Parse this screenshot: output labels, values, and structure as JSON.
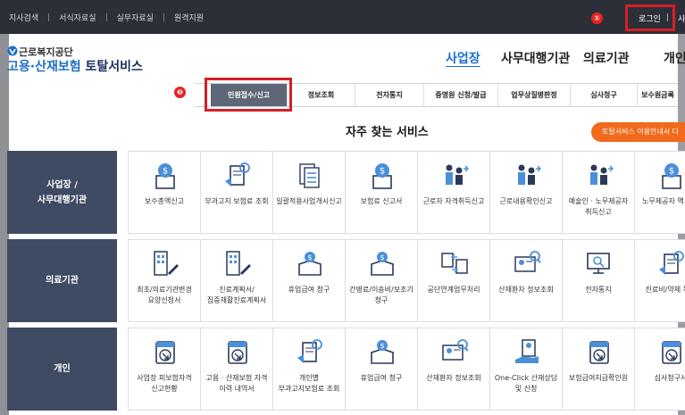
{
  "utility_links": [
    "지사검색",
    "서식자료실",
    "실무자료실",
    "원격지원"
  ],
  "login": "로그인",
  "cut_menu": "사",
  "badges": {
    "one": "①",
    "two": "❷"
  },
  "org_name": "근로복지공단",
  "service_title": {
    "accent": "고용·산재보험",
    "rest": " 토탈서비스"
  },
  "main_nav": [
    "사업장",
    "사무대행기관",
    "의료기관",
    "개인"
  ],
  "sub_nav": [
    "민원접수/신고",
    "정보조회",
    "전자통지",
    "증명원 신청/발급",
    "업무상질병판정",
    "심사청구",
    "보수원금록"
  ],
  "section_title": "자주 찾는 서비스",
  "guide_button": "토탈서비스 이용안내서 다",
  "categories": [
    {
      "line1": "사업장 /",
      "line2": "사무대행기관"
    },
    {
      "line1": "의료기관",
      "line2": ""
    },
    {
      "line1": "개인",
      "line2": ""
    }
  ],
  "rows": [
    [
      {
        "label": "보수총액신고",
        "icon": "coin-doc-icon"
      },
      {
        "label": "부과고지 보험료 조회",
        "icon": "receipt-search-icon"
      },
      {
        "label": "일괄적용사업개시신고",
        "icon": "stacked-docs-icon"
      },
      {
        "label": "보험료 신고서",
        "icon": "coin-doc-icon"
      },
      {
        "label": "근로자 자격취득신고",
        "icon": "workers-arrow-icon"
      },
      {
        "label": "근로내용확인신고",
        "icon": "workers-arrow-icon"
      },
      {
        "label": "예술인 · 노무제공자 취득신고",
        "icon": "workers-arrow-icon"
      },
      {
        "label": "노무제공자 액 신고",
        "icon": "coin-doc-icon"
      }
    ],
    [
      {
        "label": "최초/의료기관변경 요양신청서",
        "icon": "building-pen-icon"
      },
      {
        "label": "진료계획서/집중재활진료계획서",
        "icon": "building-pen-icon"
      },
      {
        "label": "휴업급여 청구",
        "icon": "coin-box-icon"
      },
      {
        "label": "간병료/이송비/보조기 청구",
        "icon": "coin-box-icon"
      },
      {
        "label": "공단연계업무처리",
        "icon": "exchange-icon"
      },
      {
        "label": "산재환자 정보조회",
        "icon": "id-search-icon"
      },
      {
        "label": "전자통지",
        "icon": "monitor-search-icon"
      },
      {
        "label": "진료비/약제 목록",
        "icon": "receipt-search-icon"
      }
    ],
    [
      {
        "label": "사업장 피보험자격 신고현황",
        "icon": "download-doc-icon"
      },
      {
        "label": "고용 · 산재보험 자격 이력 내역서",
        "icon": "download-doc-icon"
      },
      {
        "label": "개인별 부과고지보험료 조회",
        "icon": "receipt-search-icon"
      },
      {
        "label": "휴업급여 청구",
        "icon": "coin-box-icon"
      },
      {
        "label": "산재환자 정보조회",
        "icon": "id-search-icon"
      },
      {
        "label": "One-Click 산재상담 및 신청",
        "icon": "hand-doc-icon"
      },
      {
        "label": "보험급여지급확인원",
        "icon": "download-doc-icon"
      },
      {
        "label": "심사청구서",
        "icon": "download-doc-icon"
      }
    ]
  ],
  "colors": {
    "topbar": "#2d2f38",
    "category": "#3f4a63",
    "accent_blue": "#1a6fd1",
    "orange": "#f26a1b",
    "red_outline": "#d61f26"
  }
}
